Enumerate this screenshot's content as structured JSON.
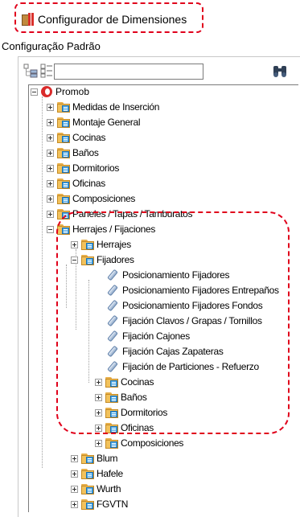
{
  "window": {
    "title": "Configurador de Dimensiones"
  },
  "config_label": "Configuração Padrão",
  "toolbar": {
    "search_value": "",
    "search_placeholder": ""
  },
  "tree": {
    "root": "Promob",
    "level1": [
      "Medidas de Inserción",
      "Montaje General",
      "Cocinas",
      "Baños",
      "Dormitorios",
      "Oficinas",
      "Composiciones",
      "Paneles / Tapas / Tamburatos",
      "Herrajes / Fijaciones"
    ],
    "herrajes_children": [
      "Herrajes",
      "Fijadores"
    ],
    "fijadores_items": [
      "Posicionamiento Fijadores",
      "Posicionamiento Fijadores Entrepaños",
      "Posicionamiento Fijadores Fondos",
      "Fijación Clavos / Grapas / Tornillos",
      "Fijación Cajones",
      "Fijación Cajas Zapateras",
      "Fijación de Particiones - Refuerzo"
    ],
    "fijadores_folders": [
      "Cocinas",
      "Baños",
      "Dormitorios",
      "Oficinas",
      "Composiciones"
    ],
    "level1_tail": [
      "Blum",
      "Hafele",
      "Wurth",
      "FGVTN"
    ]
  },
  "colors": {
    "highlight": "#e0001b",
    "folder": "#f2c25c",
    "root": "#d92b2b"
  }
}
